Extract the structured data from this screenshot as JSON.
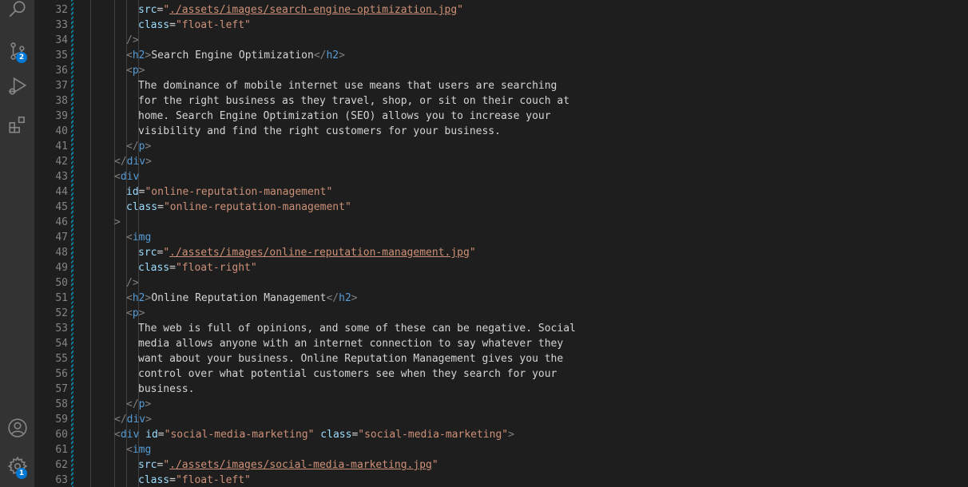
{
  "activity_bar": {
    "scm_badge": "2",
    "settings_badge": "1"
  },
  "colors": {
    "tag": "#569cd6",
    "attribute": "#9cdcfe",
    "string": "#ce9178",
    "text": "#d4d4d4",
    "bracket": "#808080",
    "line_number": "#858585",
    "badge": "#0078d4"
  },
  "editor": {
    "first_line": 32,
    "lines": [
      {
        "n": "32",
        "indent": 3,
        "tokens": [
          {
            "c": "attr",
            "t": "src"
          },
          {
            "c": "text",
            "t": "="
          },
          {
            "c": "str",
            "t": "\""
          },
          {
            "c": "link",
            "t": "./assets/images/search-engine-optimization.jpg"
          },
          {
            "c": "str",
            "t": "\""
          }
        ]
      },
      {
        "n": "33",
        "indent": 3,
        "tokens": [
          {
            "c": "attr",
            "t": "class"
          },
          {
            "c": "text",
            "t": "="
          },
          {
            "c": "str",
            "t": "\"float-left\""
          }
        ]
      },
      {
        "n": "34",
        "indent": 2,
        "tokens": [
          {
            "c": "bracket",
            "t": "/>"
          }
        ]
      },
      {
        "n": "35",
        "indent": 2,
        "tokens": [
          {
            "c": "bracket",
            "t": "<"
          },
          {
            "c": "tag",
            "t": "h2"
          },
          {
            "c": "bracket",
            "t": ">"
          },
          {
            "c": "text",
            "t": "Search Engine Optimization"
          },
          {
            "c": "bracket",
            "t": "</"
          },
          {
            "c": "tag",
            "t": "h2"
          },
          {
            "c": "bracket",
            "t": ">"
          }
        ]
      },
      {
        "n": "36",
        "indent": 2,
        "tokens": [
          {
            "c": "bracket",
            "t": "<"
          },
          {
            "c": "tag",
            "t": "p"
          },
          {
            "c": "bracket",
            "t": ">"
          }
        ]
      },
      {
        "n": "37",
        "indent": 3,
        "tokens": [
          {
            "c": "text",
            "t": "The dominance of mobile internet use means that users are searching"
          }
        ]
      },
      {
        "n": "38",
        "indent": 3,
        "tokens": [
          {
            "c": "text",
            "t": "for the right business as they travel, shop, or sit on their couch at"
          }
        ]
      },
      {
        "n": "39",
        "indent": 3,
        "tokens": [
          {
            "c": "text",
            "t": "home. Search Engine Optimization (SEO) allows you to increase your"
          }
        ]
      },
      {
        "n": "40",
        "indent": 3,
        "tokens": [
          {
            "c": "text",
            "t": "visibility and find the right customers for your business."
          }
        ]
      },
      {
        "n": "41",
        "indent": 2,
        "tokens": [
          {
            "c": "bracket",
            "t": "</"
          },
          {
            "c": "tag",
            "t": "p"
          },
          {
            "c": "bracket",
            "t": ">"
          }
        ]
      },
      {
        "n": "42",
        "indent": 1,
        "tokens": [
          {
            "c": "bracket",
            "t": "</"
          },
          {
            "c": "tag",
            "t": "div"
          },
          {
            "c": "bracket",
            "t": ">"
          }
        ]
      },
      {
        "n": "43",
        "indent": 1,
        "tokens": [
          {
            "c": "bracket",
            "t": "<"
          },
          {
            "c": "tag",
            "t": "div"
          }
        ]
      },
      {
        "n": "44",
        "indent": 2,
        "tokens": [
          {
            "c": "attr",
            "t": "id"
          },
          {
            "c": "text",
            "t": "="
          },
          {
            "c": "str",
            "t": "\"online-reputation-management\""
          }
        ]
      },
      {
        "n": "45",
        "indent": 2,
        "tokens": [
          {
            "c": "attr",
            "t": "class"
          },
          {
            "c": "text",
            "t": "="
          },
          {
            "c": "str",
            "t": "\"online-reputation-management\""
          }
        ]
      },
      {
        "n": "46",
        "indent": 1,
        "tokens": [
          {
            "c": "bracket",
            "t": ">"
          }
        ]
      },
      {
        "n": "47",
        "indent": 2,
        "tokens": [
          {
            "c": "bracket",
            "t": "<"
          },
          {
            "c": "tag",
            "t": "img"
          }
        ]
      },
      {
        "n": "48",
        "indent": 3,
        "tokens": [
          {
            "c": "attr",
            "t": "src"
          },
          {
            "c": "text",
            "t": "="
          },
          {
            "c": "str",
            "t": "\""
          },
          {
            "c": "link",
            "t": "./assets/images/online-reputation-management.jpg"
          },
          {
            "c": "str",
            "t": "\""
          }
        ]
      },
      {
        "n": "49",
        "indent": 3,
        "tokens": [
          {
            "c": "attr",
            "t": "class"
          },
          {
            "c": "text",
            "t": "="
          },
          {
            "c": "str",
            "t": "\"float-right\""
          }
        ]
      },
      {
        "n": "50",
        "indent": 2,
        "tokens": [
          {
            "c": "bracket",
            "t": "/>"
          }
        ]
      },
      {
        "n": "51",
        "indent": 2,
        "tokens": [
          {
            "c": "bracket",
            "t": "<"
          },
          {
            "c": "tag",
            "t": "h2"
          },
          {
            "c": "bracket",
            "t": ">"
          },
          {
            "c": "text",
            "t": "Online Reputation Management"
          },
          {
            "c": "bracket",
            "t": "</"
          },
          {
            "c": "tag",
            "t": "h2"
          },
          {
            "c": "bracket",
            "t": ">"
          }
        ]
      },
      {
        "n": "52",
        "indent": 2,
        "tokens": [
          {
            "c": "bracket",
            "t": "<"
          },
          {
            "c": "tag",
            "t": "p"
          },
          {
            "c": "bracket",
            "t": ">"
          }
        ]
      },
      {
        "n": "53",
        "indent": 3,
        "tokens": [
          {
            "c": "text",
            "t": "The web is full of opinions, and some of these can be negative. Social"
          }
        ]
      },
      {
        "n": "54",
        "indent": 3,
        "tokens": [
          {
            "c": "text",
            "t": "media allows anyone with an internet connection to say whatever they"
          }
        ]
      },
      {
        "n": "55",
        "indent": 3,
        "tokens": [
          {
            "c": "text",
            "t": "want about your business. Online Reputation Management gives you the"
          }
        ]
      },
      {
        "n": "56",
        "indent": 3,
        "tokens": [
          {
            "c": "text",
            "t": "control over what potential customers see when they search for your"
          }
        ]
      },
      {
        "n": "57",
        "indent": 3,
        "tokens": [
          {
            "c": "text",
            "t": "business."
          }
        ]
      },
      {
        "n": "58",
        "indent": 2,
        "tokens": [
          {
            "c": "bracket",
            "t": "</"
          },
          {
            "c": "tag",
            "t": "p"
          },
          {
            "c": "bracket",
            "t": ">"
          }
        ]
      },
      {
        "n": "59",
        "indent": 1,
        "tokens": [
          {
            "c": "bracket",
            "t": "</"
          },
          {
            "c": "tag",
            "t": "div"
          },
          {
            "c": "bracket",
            "t": ">"
          }
        ]
      },
      {
        "n": "60",
        "indent": 1,
        "tokens": [
          {
            "c": "bracket",
            "t": "<"
          },
          {
            "c": "tag",
            "t": "div"
          },
          {
            "c": "text",
            "t": " "
          },
          {
            "c": "attr",
            "t": "id"
          },
          {
            "c": "text",
            "t": "="
          },
          {
            "c": "str",
            "t": "\"social-media-marketing\""
          },
          {
            "c": "text",
            "t": " "
          },
          {
            "c": "attr",
            "t": "class"
          },
          {
            "c": "text",
            "t": "="
          },
          {
            "c": "str",
            "t": "\"social-media-marketing\""
          },
          {
            "c": "bracket",
            "t": ">"
          }
        ]
      },
      {
        "n": "61",
        "indent": 2,
        "tokens": [
          {
            "c": "bracket",
            "t": "<"
          },
          {
            "c": "tag",
            "t": "img"
          }
        ]
      },
      {
        "n": "62",
        "indent": 3,
        "tokens": [
          {
            "c": "attr",
            "t": "src"
          },
          {
            "c": "text",
            "t": "="
          },
          {
            "c": "str",
            "t": "\""
          },
          {
            "c": "link",
            "t": "./assets/images/social-media-marketing.jpg"
          },
          {
            "c": "str",
            "t": "\""
          }
        ]
      },
      {
        "n": "63",
        "indent": 3,
        "tokens": [
          {
            "c": "attr",
            "t": "class"
          },
          {
            "c": "text",
            "t": "="
          },
          {
            "c": "str",
            "t": "\"float-left\""
          }
        ]
      }
    ]
  }
}
